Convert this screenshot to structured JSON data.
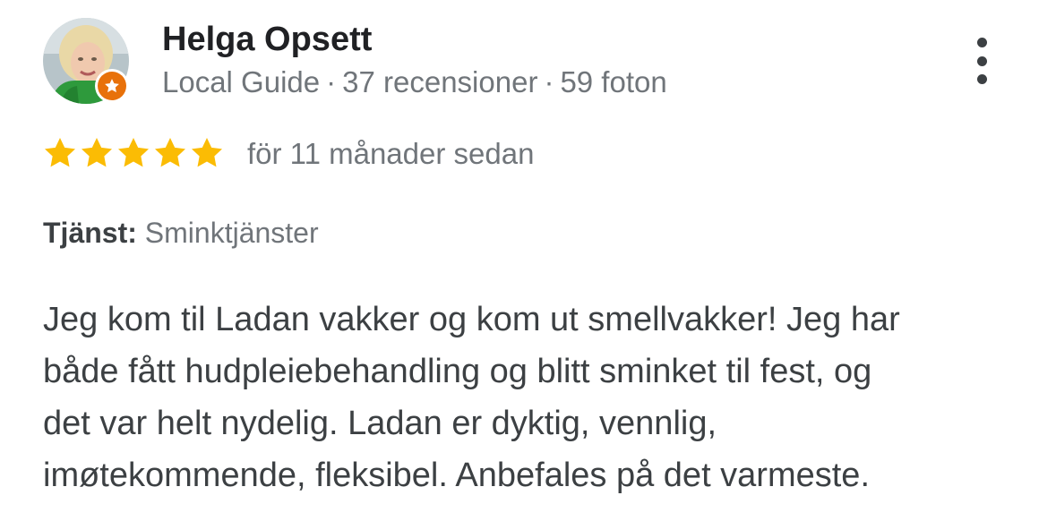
{
  "reviewer": {
    "name": "Helga Opsett",
    "guide_label": "Local Guide",
    "separator": "·",
    "reviews_count": "37 recensioner",
    "photos_count": "59 foton",
    "avatar_icon": "user-photo",
    "badge_icon": "local-guide-star-badge",
    "badge_color": "#e8710a"
  },
  "rating": {
    "stars": 5,
    "max_stars": 5,
    "star_color": "#fbbc04",
    "date": "för 11 månader sedan"
  },
  "service": {
    "label": "Tjänst:",
    "value": "Sminktjänster"
  },
  "review": {
    "lines": [
      "Jeg kom til Ladan vakker og kom ut smellvakker! Jeg har",
      "både fått hudpleiebehandling og blitt sminket til fest, og",
      "det var helt nydelig. Ladan er dyktig, vennlig,",
      "imøtekommende, fleksibel. Anbefales på det varmeste."
    ]
  },
  "actions": {
    "more_icon": "more-vert-icon"
  }
}
